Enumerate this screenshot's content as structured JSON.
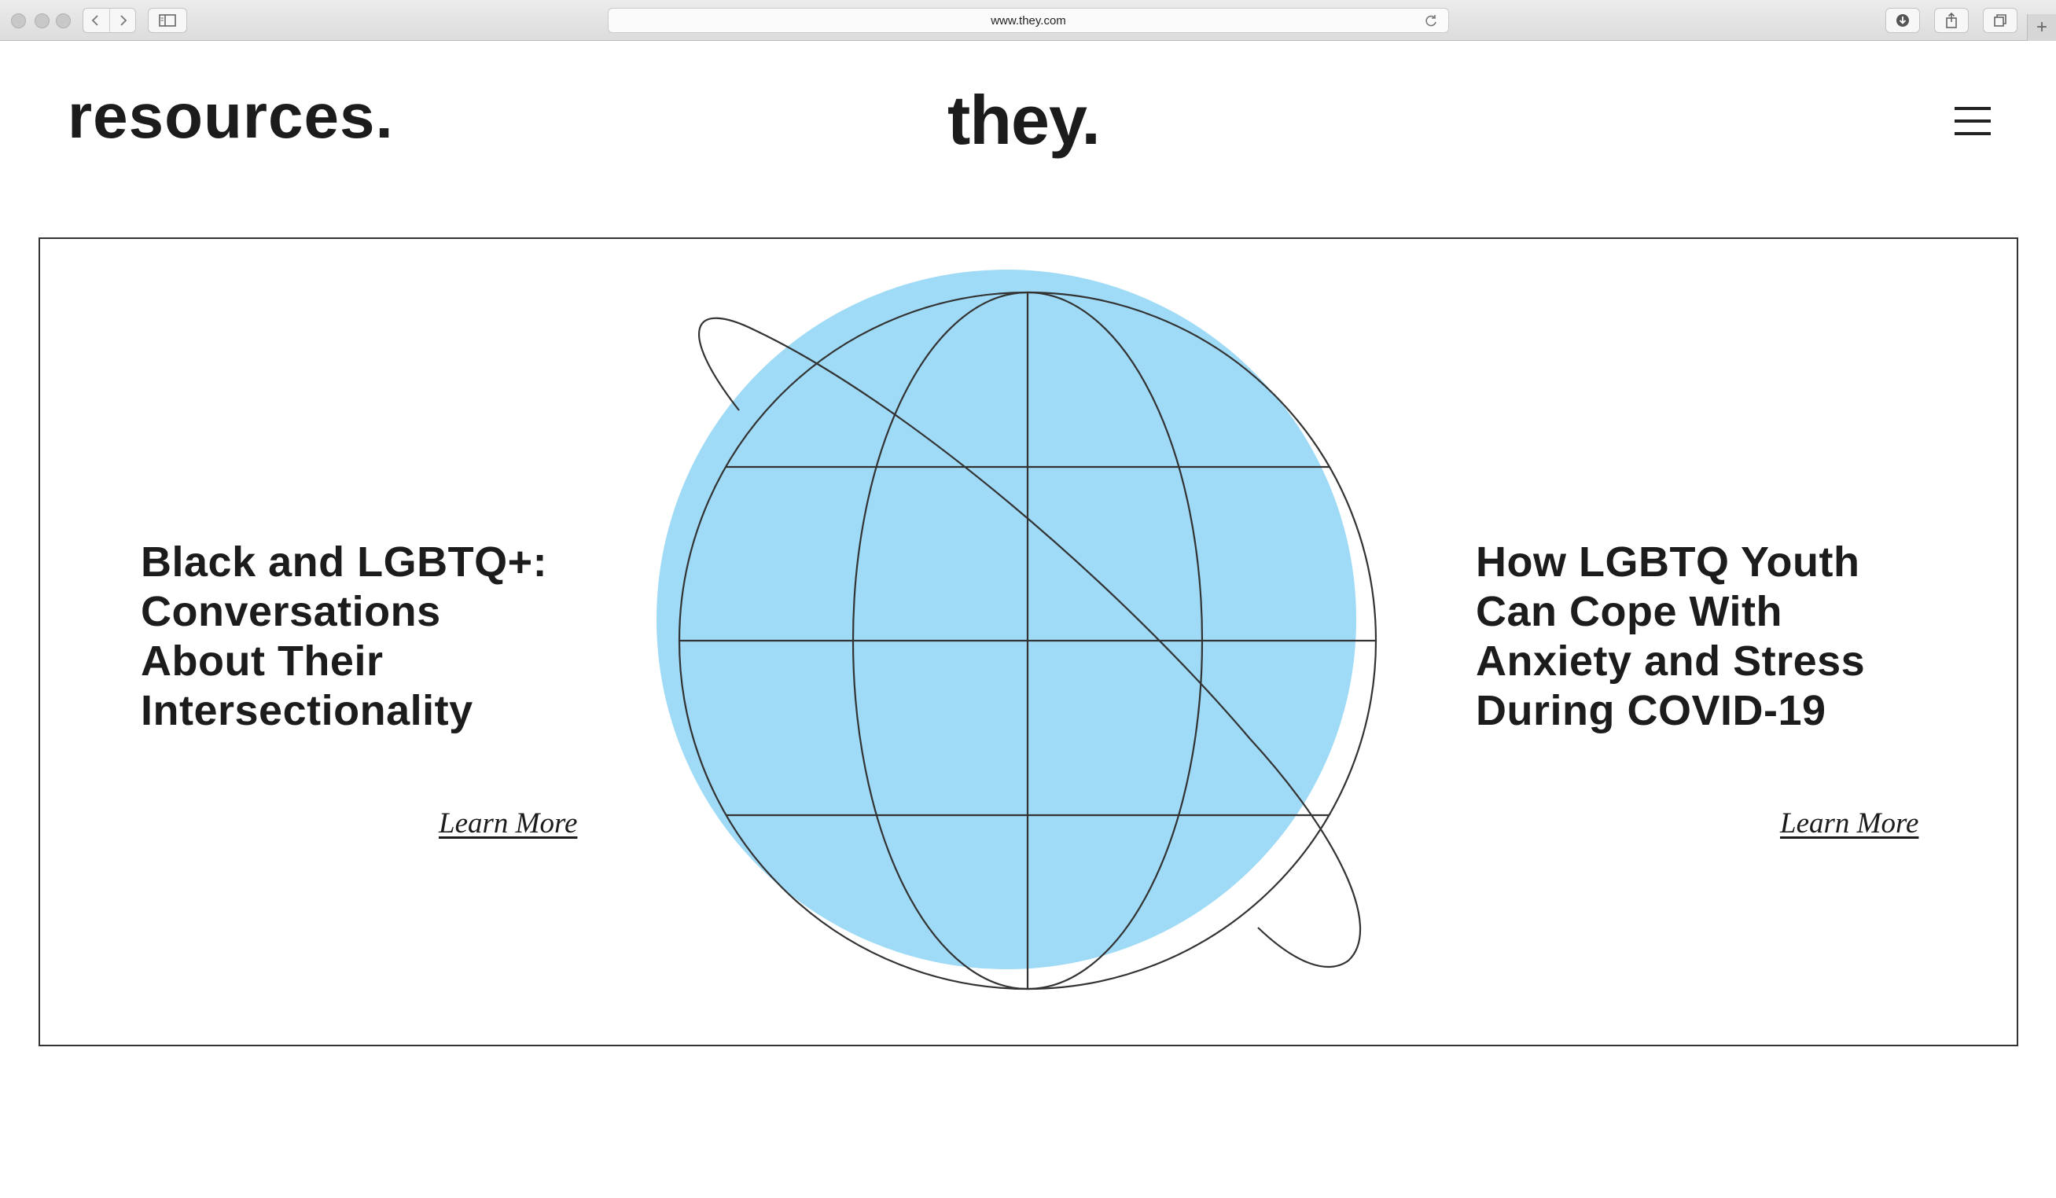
{
  "browser": {
    "url": "www.they.com",
    "new_tab_label": "+"
  },
  "header": {
    "section_title": "resources.",
    "logo": "they."
  },
  "articles": [
    {
      "title_lines": [
        "Black and LGBTQ+:",
        "Conversations",
        "About Their",
        "Intersectionality"
      ],
      "link": "Learn More"
    },
    {
      "title_lines": [
        "How LGBTQ Youth",
        "Can Cope With",
        "Anxiety and Stress",
        "During COVID-19"
      ],
      "link": "Learn More"
    }
  ],
  "colors": {
    "globe_fill": "#9fdbf6",
    "line": "#333333"
  },
  "icons": {
    "menu": "hamburger-menu-icon",
    "back": "chevron-left-icon",
    "forward": "chevron-right-icon",
    "sidebar": "sidebar-icon",
    "reload": "reload-icon",
    "download": "download-icon",
    "share": "share-icon",
    "tabs": "tabs-icon"
  }
}
